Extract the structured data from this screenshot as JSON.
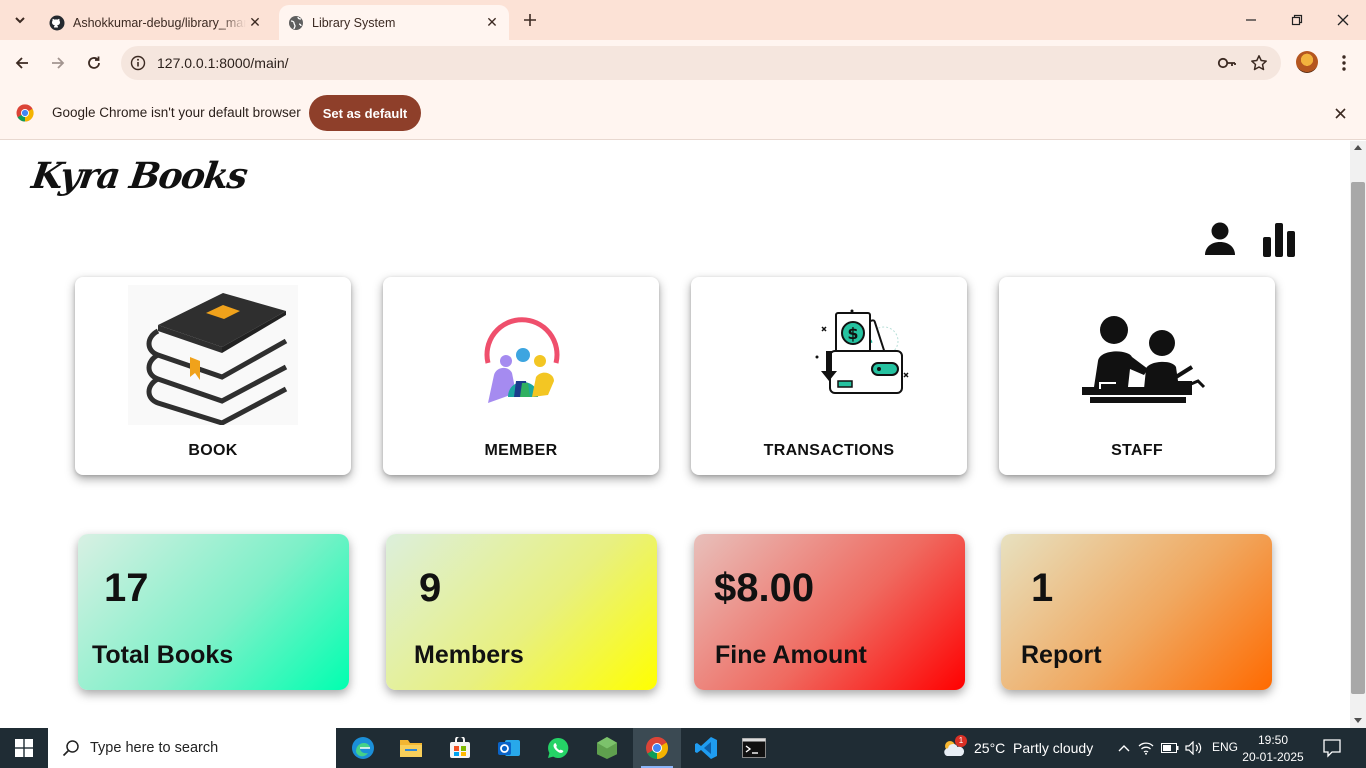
{
  "browser": {
    "tabs": [
      {
        "title": "Ashokkumar-debug/library_management",
        "favicon": "github-icon",
        "active": false
      },
      {
        "title": "Library System",
        "favicon": "globe-icon",
        "active": true
      }
    ],
    "url": "127.0.0.1:8000/main/",
    "infobar": {
      "message": "Google Chrome isn't your default browser",
      "button": "Set as default"
    }
  },
  "page": {
    "logo": "Kyra Books",
    "header_icons": [
      "user-icon",
      "bar-chart-icon"
    ],
    "cards": [
      {
        "label": "BOOK",
        "icon": "books-stack-illustration"
      },
      {
        "label": "MEMBER",
        "icon": "members-group-illustration"
      },
      {
        "label": "TRANSACTIONS",
        "icon": "wallet-money-illustration"
      },
      {
        "label": "STAFF",
        "icon": "teacher-student-illustration"
      }
    ],
    "stats": [
      {
        "value": "17",
        "label": "Total Books",
        "gradient": [
          "#d8f0e3",
          "#00ffb0"
        ]
      },
      {
        "value": "9",
        "label": "Members",
        "gradient": [
          "#dcefdc",
          "#ffff00"
        ]
      },
      {
        "value": "$8.00",
        "label": "Fine Amount",
        "gradient": [
          "#e8c0bb",
          "#ff0000"
        ]
      },
      {
        "value": "1",
        "label": "Report",
        "gradient": [
          "#e7e1c0",
          "#ff6a00"
        ]
      }
    ]
  },
  "taskbar": {
    "search_placeholder": "Type here to search",
    "apps": [
      "edge-icon",
      "file-explorer-icon",
      "store-icon",
      "outlook-icon",
      "whatsapp-icon",
      "nodejs-icon",
      "chrome-icon",
      "vscode-icon",
      "terminal-icon"
    ],
    "weather": "25°C  Partly cloudy",
    "weather_badge": "1",
    "language": "ENG",
    "time": "19:50",
    "date": "20-01-2025"
  },
  "colors": {
    "tabstrip": "#fce2d6",
    "toolbar": "#fff5f0",
    "set_default_button": "#8e3f2a",
    "taskbar": "#1f2c34"
  }
}
